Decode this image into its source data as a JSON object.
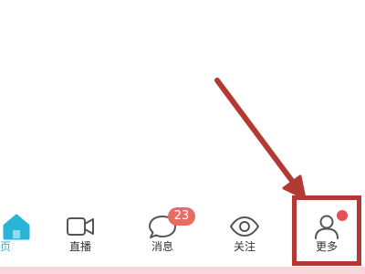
{
  "tabbar": {
    "tabs": [
      {
        "label": "页",
        "icon": "home-icon",
        "active": true
      },
      {
        "label": "直播",
        "icon": "video-camera-icon"
      },
      {
        "label": "消息",
        "icon": "chat-bubble-icon",
        "badge": "23"
      },
      {
        "label": "关注",
        "icon": "eye-icon"
      },
      {
        "label": "更多",
        "icon": "user-profile-icon",
        "dot": true
      }
    ]
  },
  "colors": {
    "active": "#2ab4d8",
    "badge": "#ea6b63",
    "annotation": "#b33a33",
    "bottom_strip": "#f7d7dc"
  }
}
